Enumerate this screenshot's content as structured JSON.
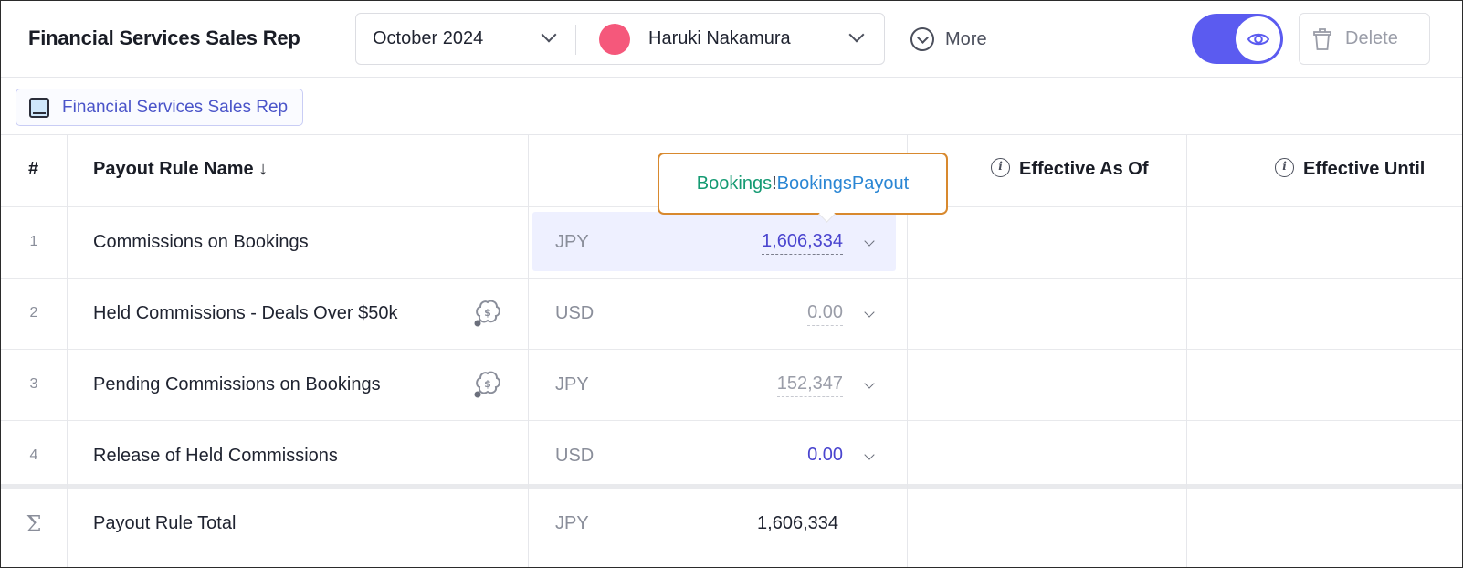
{
  "header": {
    "title": "Financial Services Sales Rep",
    "period": "October 2024",
    "user": "Haruki Nakamura",
    "user_color": "#f5587b",
    "more_label": "More",
    "delete_label": "Delete",
    "toggle_color": "#5b5bf0"
  },
  "tag": {
    "label": "Financial Services Sales Rep"
  },
  "table": {
    "headers": {
      "num": "#",
      "name": "Payout Rule Name ↓",
      "effective_as_of": "Effective As Of",
      "effective_until": "Effective Until"
    },
    "rows": [
      {
        "num": "1",
        "name": "Commissions on Bookings",
        "currency": "JPY",
        "amount": "1,606,334"
      },
      {
        "num": "2",
        "name": "Held Commissions - Deals Over $50k",
        "currency": "USD",
        "amount": "0.00"
      },
      {
        "num": "3",
        "name": "Pending Commissions on Bookings",
        "currency": "JPY",
        "amount": "152,347"
      },
      {
        "num": "4",
        "name": "Release of Held Commissions",
        "currency": "USD",
        "amount": "0.00"
      }
    ],
    "total": {
      "symbol": "Σ",
      "label": "Payout Rule Total",
      "currency": "JPY",
      "amount": "1,606,334"
    }
  },
  "tooltip": {
    "source": "Bookings",
    "separator": "!",
    "field": "BookingsPayout"
  },
  "icons": [
    "book-icon",
    "chevron-down-icon",
    "more-circle-icon",
    "eye-icon",
    "trash-icon",
    "payout-cycle-icon",
    "info-icon",
    "sigma-icon"
  ]
}
